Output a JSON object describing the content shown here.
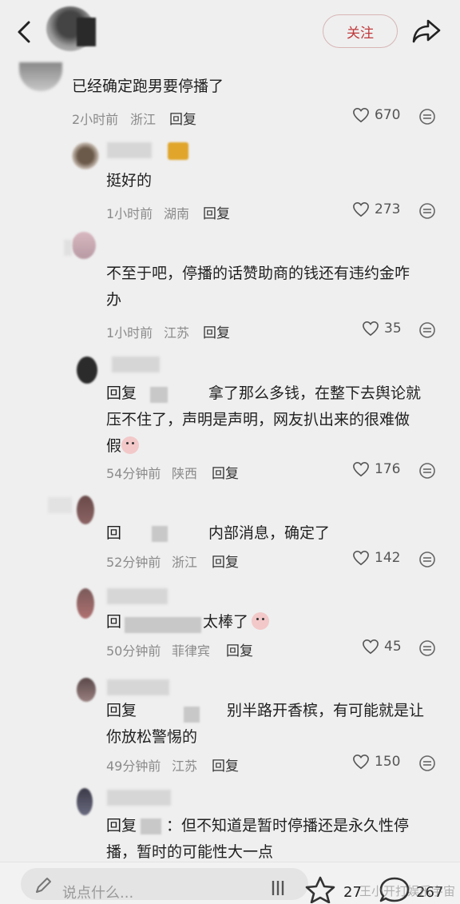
{
  "header": {
    "follow_label": "关注"
  },
  "comments": [
    {
      "text": "已经确定跑男要停播了",
      "time": "2小时前",
      "location": "浙江",
      "reply": "回复",
      "likes": "670"
    },
    {
      "text": "挺好的",
      "time": "1小时前",
      "location": "湖南",
      "reply": "回复",
      "likes": "273"
    },
    {
      "line1": "不至于吧，停播的话赞助商的钱还有违约金咋",
      "line2": "办",
      "time": "1小时前",
      "location": "江苏",
      "reply": "回复",
      "likes": "35"
    },
    {
      "prefix": "回复",
      "line1": "拿了那么多钱，在整下去舆论就",
      "line2": "压不住了，声明是声明，网友扒出来的很难做",
      "line3": "假",
      "time": "54分钟前",
      "location": "陕西",
      "reply": "回复",
      "likes": "176"
    },
    {
      "prefix": "回",
      "text": "内部消息，确定了",
      "time": "52分钟前",
      "location": "浙江",
      "reply": "回复",
      "likes": "142"
    },
    {
      "prefix": "回",
      "text": "太棒了",
      "time": "50分钟前",
      "location": "菲律宾",
      "reply": "回复",
      "likes": "45"
    },
    {
      "prefix": "回复",
      "line1": "别半路开香槟，有可能就是让",
      "line2": "你放松警惕的",
      "time": "49分钟前",
      "location": "江苏",
      "reply": "回复",
      "likes": "150"
    },
    {
      "prefix": "回复",
      "line1": "：但不知道是暂时停播还是永久性停",
      "line2": "播，暂时的可能性大一点"
    }
  ],
  "bottom": {
    "placeholder": "说点什么...",
    "star_count": "27",
    "comment_count": "267",
    "watermark": "王小开打娱乐宇宙"
  }
}
